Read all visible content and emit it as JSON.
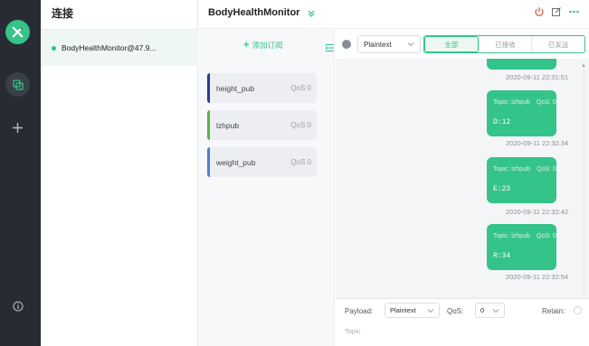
{
  "colors": {
    "accent": "#34c388",
    "rail": "#272b33"
  },
  "rail": {
    "logo_icon": "mqttx-logo",
    "items": [
      {
        "icon": "connections-icon",
        "active": true
      },
      {
        "icon": "plus-icon",
        "active": false
      },
      {
        "icon": "info-icon",
        "active": false
      }
    ]
  },
  "connections": {
    "title": "连接",
    "items": [
      {
        "name": "BodyHealthMonitor@47.9...",
        "online": true
      }
    ]
  },
  "header": {
    "title": "BodyHealthMonitor",
    "icons": [
      "chevron-down-icon",
      "power-icon",
      "edit-icon",
      "more-icon"
    ]
  },
  "subscriptions": {
    "add_label": "添加订阅",
    "items": [
      {
        "topic": "height_pub",
        "qos": "QoS 0",
        "color": "#2a3a9a"
      },
      {
        "topic": "lzhpub",
        "qos": "QoS 0",
        "color": "#55b34a"
      },
      {
        "topic": "weight_pub",
        "qos": "QoS 0",
        "color": "#4a7fd6"
      }
    ]
  },
  "messages": {
    "format": "Plaintext",
    "filters": [
      "全部",
      "已接收",
      "已发送"
    ],
    "active_filter": 0,
    "items": [
      {
        "topic": "",
        "qos": "",
        "payload": "",
        "time": "2020-09-11 22:31:51"
      },
      {
        "topic": "Topic: lzhpub",
        "qos": "QoS: 0",
        "payload": "D:12",
        "time": "2020-09-11 22:32:34"
      },
      {
        "topic": "Topic: lzhpub",
        "qos": "QoS: 0",
        "payload": "E:23",
        "time": "2020-09-11 22:32:42"
      },
      {
        "topic": "Topic: lzhpub",
        "qos": "QoS: 0",
        "payload": "R:34",
        "time": "2020-09-11 22:32:54"
      }
    ]
  },
  "publish": {
    "payload_label": "Payload:",
    "payload_format": "Plaintext",
    "qos_label": "QoS:",
    "qos_value": "0",
    "retain_label": "Retain:",
    "topic_placeholder": "Topic"
  }
}
